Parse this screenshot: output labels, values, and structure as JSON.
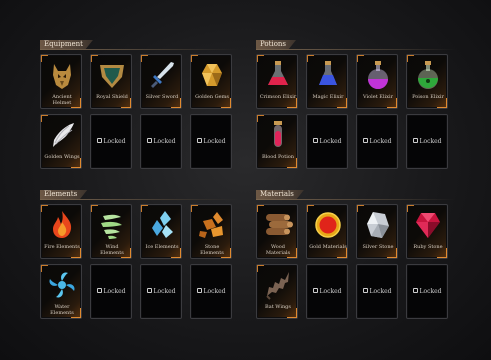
{
  "sections": {
    "equipment": {
      "title": "Equipment",
      "items": [
        "Ancient Helmet",
        "Royal Shield",
        "Silver Sword",
        "Golden Gems",
        "Golden Wings"
      ],
      "locked_label": "Locked"
    },
    "potions": {
      "title": "Potions",
      "items": [
        "Crimson Elixir",
        "Magic Elixir",
        "Violet Elixir",
        "Poison Elixir",
        "Blood Potion"
      ],
      "locked_label": "Locked"
    },
    "elements": {
      "title": "Elements",
      "items": [
        "Fire Elements",
        "Wind Elements",
        "Ice Elements",
        "Stone Elements",
        "Water Elements"
      ],
      "locked_label": "Locked"
    },
    "materials": {
      "title": "Materials",
      "items": [
        "Wood Materials",
        "Gold Materials",
        "Silver Stone",
        "Ruby Stone",
        "Bat Wings"
      ],
      "locked_label": "Locked"
    }
  },
  "icons": {
    "equipment": [
      "wolf-helmet-icon",
      "shield-icon",
      "sword-icon",
      "gem-icon",
      "wings-icon"
    ],
    "potions": [
      "red-flask-icon",
      "blue-flask-icon",
      "violet-flask-icon",
      "green-flask-icon",
      "blood-vial-icon"
    ],
    "elements": [
      "fire-icon",
      "wind-icon",
      "ice-icon",
      "stone-icon",
      "water-icon"
    ],
    "materials": [
      "logs-icon",
      "gold-coin-icon",
      "silver-stone-icon",
      "ruby-icon",
      "bat-wing-icon"
    ]
  },
  "colors": {
    "accent": "#e08a30",
    "banner": "#6d5845",
    "slot_border": "#3b3b3f"
  }
}
